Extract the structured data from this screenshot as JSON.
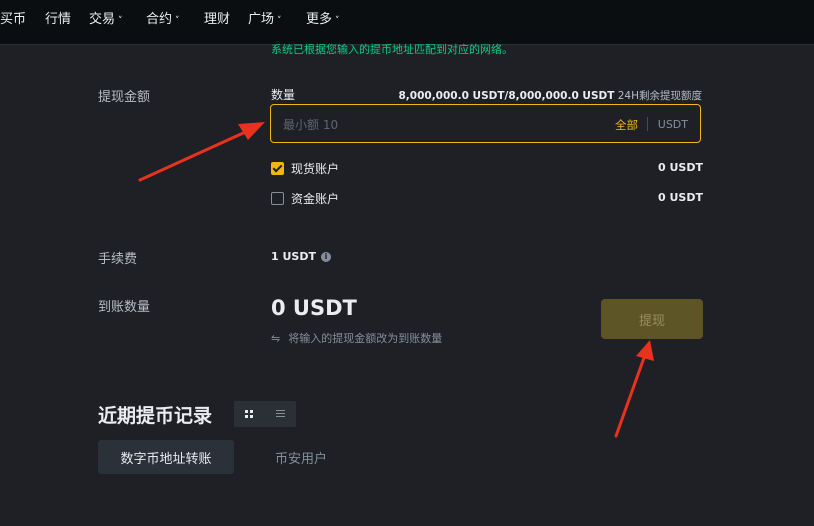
{
  "nav": {
    "items": [
      {
        "label": "买币",
        "dropdown": false
      },
      {
        "label": "行情",
        "dropdown": false
      },
      {
        "label": "交易",
        "dropdown": true
      },
      {
        "label": "合约",
        "dropdown": true
      },
      {
        "label": "理财",
        "dropdown": false
      },
      {
        "label": "广场",
        "dropdown": true
      },
      {
        "label": "更多",
        "dropdown": true
      }
    ],
    "chevron": "˅"
  },
  "notice": "系统已根据您输入的提币地址匹配到对应的网络。",
  "withdraw_amount": {
    "label": "提现金额",
    "qty_label": "数量",
    "quota_value": "8,000,000.0 USDT/8,000,000.0 USDT",
    "quota_text": "24H剩余提现额度",
    "input_value": "",
    "input_placeholder": "最小额 10",
    "all_label": "全部",
    "unit": "USDT"
  },
  "accounts": [
    {
      "label": "现货账户",
      "checked": true,
      "value": "0 USDT"
    },
    {
      "label": "资金账户",
      "checked": false,
      "value": "0 USDT"
    }
  ],
  "fee": {
    "label": "手续费",
    "value": "1 USDT",
    "info_icon": "i"
  },
  "receive": {
    "label": "到账数量",
    "value": "0 USDT",
    "swap_icon": "⇋",
    "swap_hint": "将输入的提现金额改为到账数量",
    "withdraw_button": "提现"
  },
  "records": {
    "title": "近期提币记录",
    "tabs": [
      {
        "label": "数字币地址转账",
        "active": true
      },
      {
        "label": "币安用户",
        "active": false
      }
    ]
  },
  "colors": {
    "accent": "#f0b90b",
    "success": "#0ecb81",
    "background": "#1e2026",
    "nav_background": "#0b0e11",
    "annotation_arrow": "#e8321e"
  }
}
